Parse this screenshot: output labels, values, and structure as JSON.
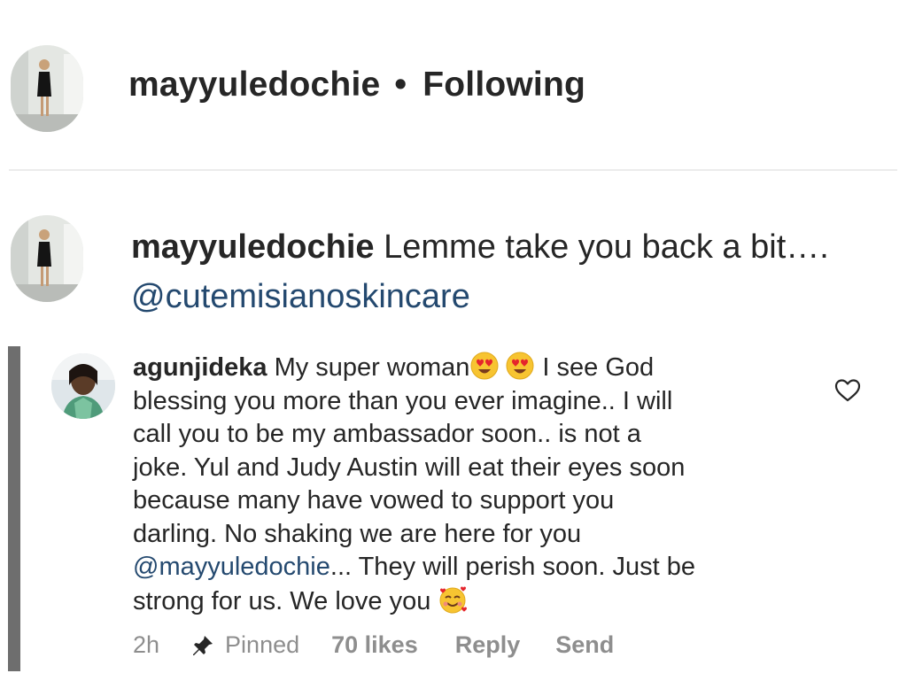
{
  "header": {
    "username": "mayyuledochie",
    "separator": "•",
    "follow_status": "Following",
    "avatar_icon": "profile-photo-woman-black-dress"
  },
  "caption": {
    "username": "mayyuledochie",
    "text": "Lemme take you back a bit….",
    "mention": "@cutemisianoskincare",
    "avatar_icon": "profile-photo-woman-black-dress"
  },
  "comment": {
    "username": "agunjideka",
    "avatar_icon": "profile-photo-woman",
    "line1_text": "My super woman",
    "line1_after": " I see God",
    "line2": "blessing you more than you ever imagine.. I will",
    "line3": "call you to be my ambassador soon.. is not a",
    "line4": "joke. Yul and Judy Austin will eat their eyes soon",
    "line5": "because many have vowed to support you",
    "line6": "darling. No shaking we are here for you",
    "line7_mention": "@mayyuledochie",
    "line7_after": "... They will perish soon. Just be",
    "line8": "strong for us. We love you",
    "emojis": [
      "heart-eyes-emoji",
      "heart-eyes-emoji",
      "smiling-face-with-hearts-emoji"
    ],
    "like_icon": "heart-outline-icon"
  },
  "meta": {
    "time": "2h",
    "pin_icon": "pin-icon",
    "pinned_label": "Pinned",
    "likes": "70 likes",
    "reply_label": "Reply",
    "send_label": "Send"
  },
  "colors": {
    "text": "#262626",
    "mention": "#24496f",
    "muted": "#8e8e8e",
    "thread_bar": "#6e6e6e",
    "divider": "#ececec"
  }
}
